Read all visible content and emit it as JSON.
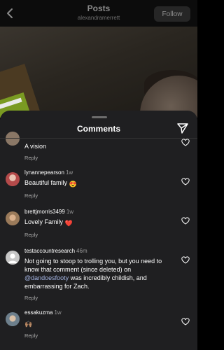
{
  "header": {
    "title": "Posts",
    "username": "alexandramerrett",
    "follow_label": "Follow"
  },
  "sheet": {
    "title": "Comments"
  },
  "comments": [
    {
      "user": "",
      "time": "",
      "text": "A vision",
      "reply": "Reply",
      "avatar_color": "#8a7766"
    },
    {
      "user": "lynannepearson",
      "time": "1w",
      "text": "Beautiful family",
      "emoji": "😍",
      "reply": "Reply",
      "avatar_color": "#b44a4a"
    },
    {
      "user": "brettjmorris3499",
      "time": "1w",
      "text": "Lovely Family",
      "emoji": "❤️",
      "reply": "Reply",
      "avatar_color": "#9a7a5a"
    },
    {
      "user": "testaccountresearch",
      "time": "46m",
      "text_before": "Not going to stoop to trolling you, but you need to know that comment (since deleted) on ",
      "mention": "@dandoesfooty",
      "text_after": " was incredibly childish, and embarrassing for Zach.",
      "reply": "Reply",
      "avatar_color": "#c7c7c7"
    },
    {
      "user": "essakuzma",
      "time": "1w",
      "text": "",
      "emoji": "🙌🏽",
      "reply": "Reply",
      "avatar_color": "#6d7f8c"
    }
  ],
  "icons": {
    "back": "chevron-left-icon",
    "send": "paper-plane-icon",
    "like": "heart-outline-icon"
  }
}
